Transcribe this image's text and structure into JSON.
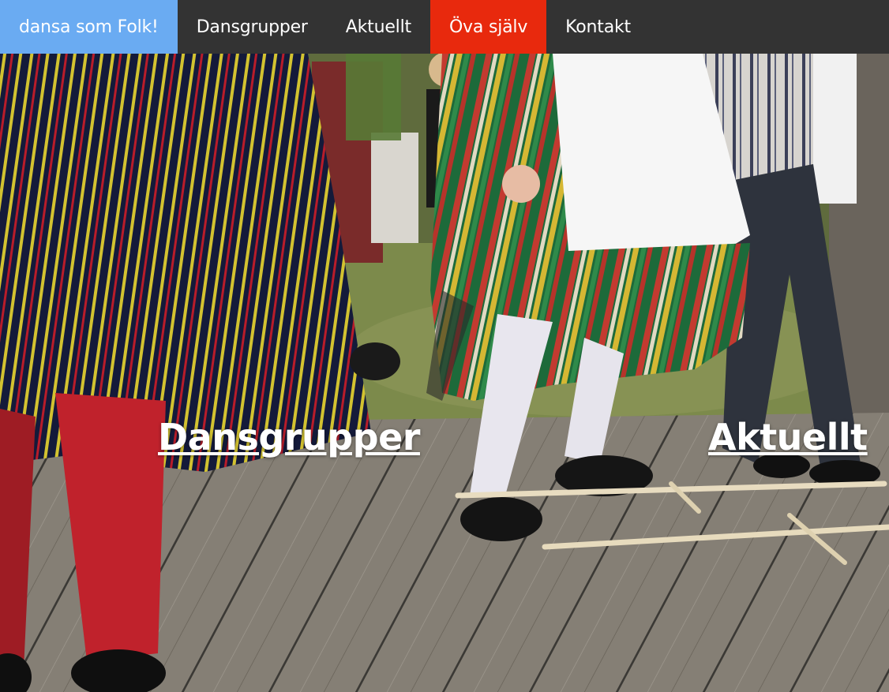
{
  "nav": {
    "brand": "dansa som Folk!",
    "items": [
      {
        "label": "Dansgrupper"
      },
      {
        "label": "Aktuellt"
      },
      {
        "label": "Öva själv"
      },
      {
        "label": "Kontakt"
      }
    ],
    "active_index": 2
  },
  "hero": {
    "tiles": [
      {
        "label": "Dansgrupper"
      },
      {
        "label": "Aktuellt"
      }
    ]
  },
  "colors": {
    "nav_background": "#333333",
    "brand_background": "#6aabf2",
    "active_background": "#e8290d",
    "text": "#ffffff"
  }
}
